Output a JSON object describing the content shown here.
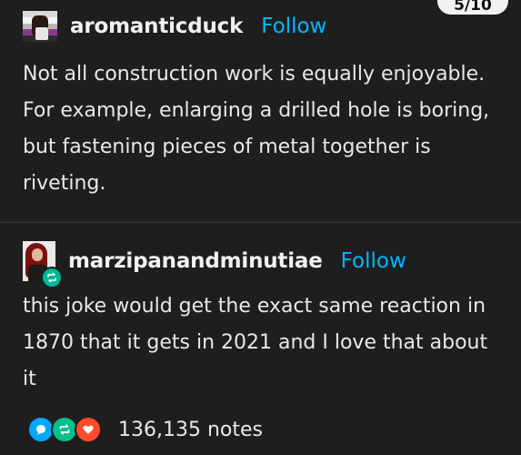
{
  "page_counter": "5/10",
  "posts": [
    {
      "username": "aromanticduck",
      "follow_label": "Follow",
      "text": "Not all construction work is equally enjoyable. For example, enlarging a drilled hole is boring, but fastening pieces of metal together is riveting."
    },
    {
      "username": "marzipanandminutiae",
      "follow_label": "Follow",
      "text": "this joke would get the exact same reaction in 1870 that it gets in 2021 and I love that about it"
    }
  ],
  "notes": {
    "count": "136,135 notes",
    "icons": [
      "reply-icon",
      "reblog-icon",
      "like-icon"
    ]
  },
  "colors": {
    "background": "#1e1e1f",
    "follow": "#00b8ff",
    "reply": "#00a8ff",
    "reblog": "#00c08b",
    "like": "#ff4a2b"
  }
}
